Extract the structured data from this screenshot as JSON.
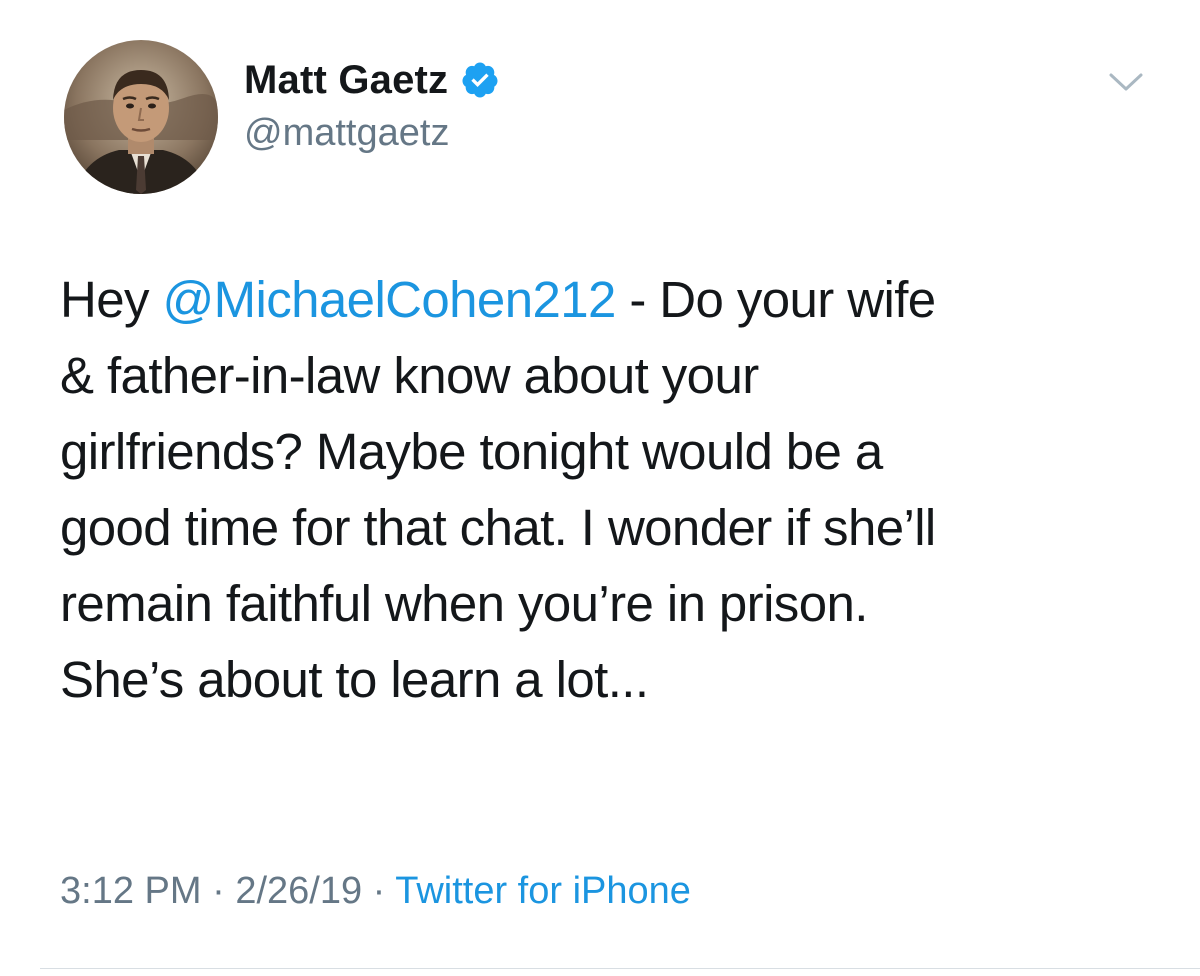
{
  "author": {
    "display_name": "Matt Gaetz",
    "handle": "@mattgaetz",
    "verified": true,
    "avatar_icon": "profile-photo"
  },
  "tweet": {
    "text_before_mention": "Hey ",
    "mention": "@MichaelCohen212",
    "text_after_mention": " - Do your wife\n& father-in-law know about your\ngirlfriends? Maybe tonight would be a\ngood time for that chat. I wonder if she’ll\nremain faithful when you’re in prison.\nShe’s about to learn a lot...",
    "time": "3:12 PM",
    "separator": " · ",
    "date": "2/26/19",
    "source": "Twitter for iPhone"
  },
  "colors": {
    "link": "#1b95e0",
    "secondary_text": "#657786",
    "primary_text": "#14171a",
    "verified_badge": "#1da1f2"
  },
  "icons": {
    "verified": "verified-badge-icon",
    "menu": "chevron-down-icon"
  }
}
